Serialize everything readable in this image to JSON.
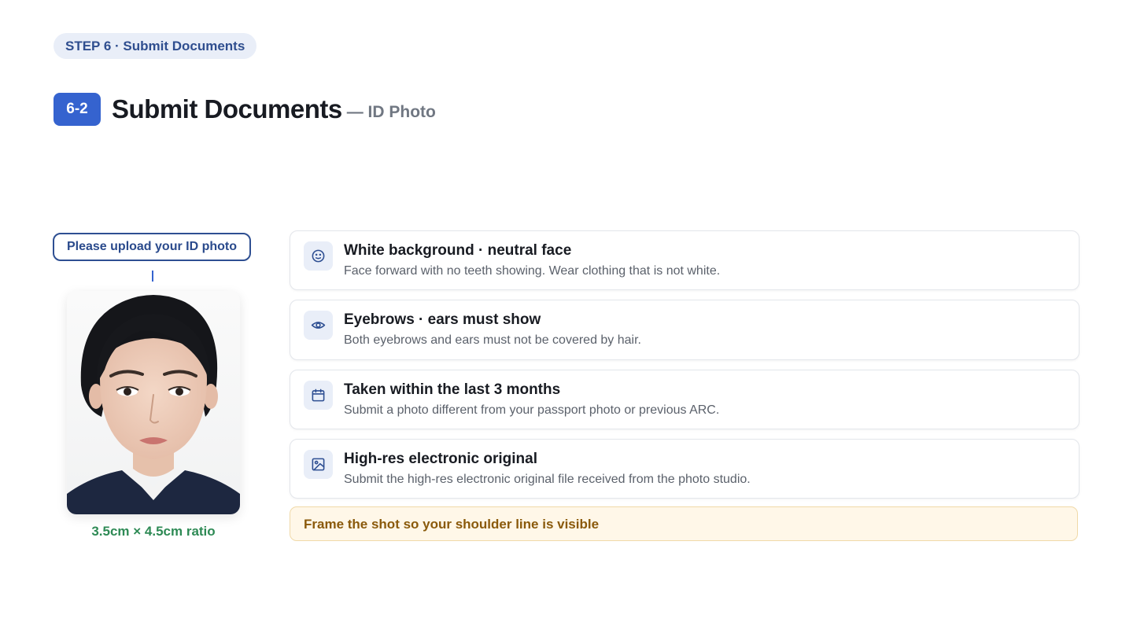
{
  "header": {
    "step_pill": "STEP 6 · Submit Documents",
    "number_badge": "6-2",
    "title": "Submit Documents",
    "subtitle": "— ID Photo"
  },
  "upload": {
    "button_label": "Please upload your ID photo",
    "ratio_caption": "3.5cm × 4.5cm ratio"
  },
  "requirements": [
    {
      "icon": "smile-face-icon",
      "title": "White background · neutral face",
      "description": "Face forward with no teeth showing. Wear clothing that is not white."
    },
    {
      "icon": "eye-icon",
      "title": "Eyebrows · ears must show",
      "description": "Both eyebrows and ears must not be covered by hair."
    },
    {
      "icon": "calendar-icon",
      "title": "Taken within the last 3 months",
      "description": "Submit a photo different from your passport photo or previous ARC."
    },
    {
      "icon": "image-icon",
      "title": "High-res electronic original",
      "description": "Submit the high-res electronic original file received from the photo studio."
    }
  ],
  "tip": "Frame the shot so your shoulder line is visible",
  "colors": {
    "accent": "#3563cf",
    "accent_dark": "#2e4f92",
    "pill_bg": "#e9eef8",
    "success_text": "#2e8a55",
    "tip_bg": "#fff7e8",
    "tip_border": "#f0d9a8",
    "tip_text": "#8a5a0b"
  }
}
